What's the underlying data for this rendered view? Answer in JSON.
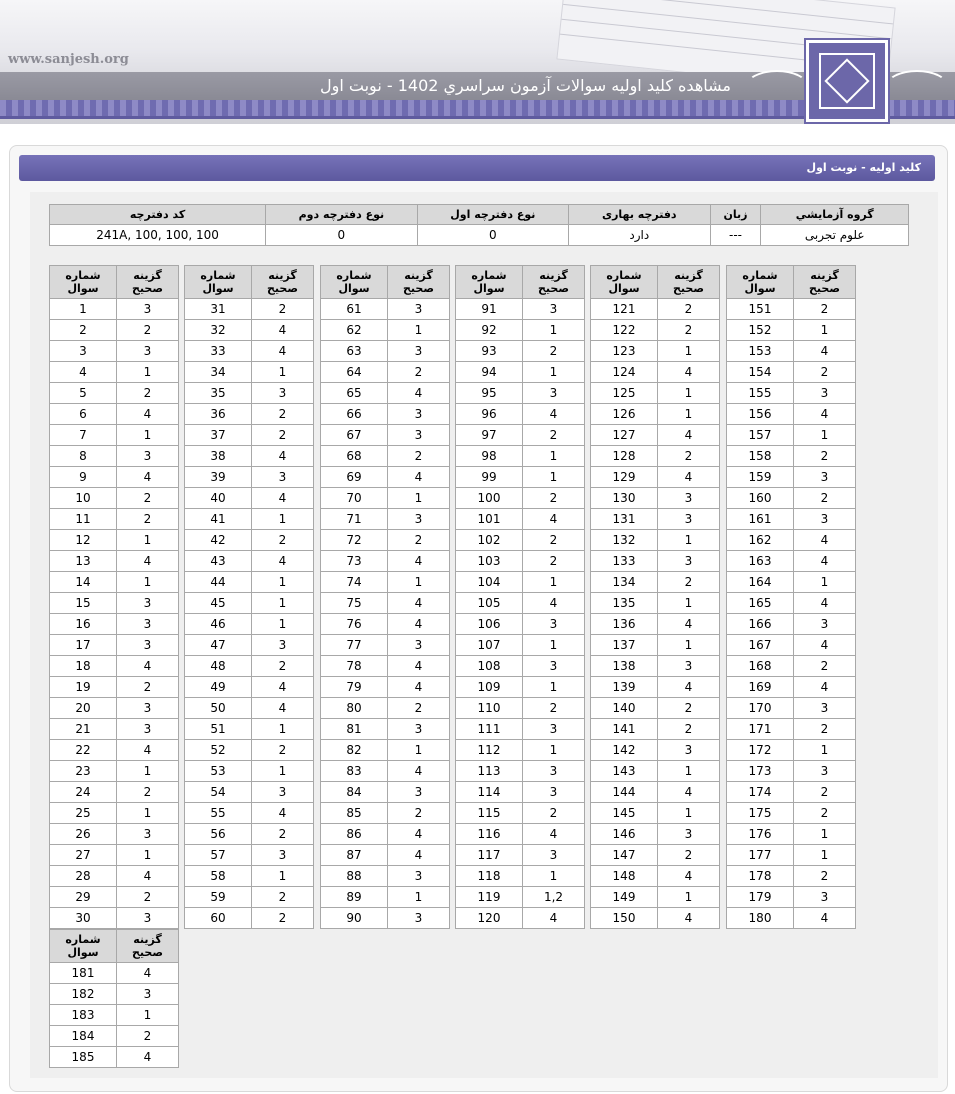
{
  "header": {
    "site": "www.sanjesh.org",
    "title": "مشاهده كليد اوليه سوالات آزمون سراسري 1402 - نوبت اول"
  },
  "panel": {
    "title": "كليد اوليه - نوبت اول"
  },
  "info": {
    "headers": [
      "كد دفترچه",
      "نوع دفترچه دوم",
      "نوع دفترچه اول",
      "دفترچه بهاری",
      "زبان",
      "گروه آزمايشي"
    ],
    "values": [
      "241A, 100, 100, 100",
      "0",
      "0",
      "دارد",
      "---",
      "علوم تجربی"
    ]
  },
  "answers": {
    "header_question": "شماره سوال",
    "header_answer": "گزينه صحيح",
    "q_header_line1": "شماره",
    "q_header_line2": "سوال",
    "a_header_line1": "گزينه",
    "a_header_line2": "صحيح",
    "rows": [
      [
        "1",
        "3"
      ],
      [
        "2",
        "2"
      ],
      [
        "3",
        "3"
      ],
      [
        "4",
        "1"
      ],
      [
        "5",
        "2"
      ],
      [
        "6",
        "4"
      ],
      [
        "7",
        "1"
      ],
      [
        "8",
        "3"
      ],
      [
        "9",
        "4"
      ],
      [
        "10",
        "2"
      ],
      [
        "11",
        "2"
      ],
      [
        "12",
        "1"
      ],
      [
        "13",
        "4"
      ],
      [
        "14",
        "1"
      ],
      [
        "15",
        "3"
      ],
      [
        "16",
        "3"
      ],
      [
        "17",
        "3"
      ],
      [
        "18",
        "4"
      ],
      [
        "19",
        "2"
      ],
      [
        "20",
        "3"
      ],
      [
        "21",
        "3"
      ],
      [
        "22",
        "4"
      ],
      [
        "23",
        "1"
      ],
      [
        "24",
        "2"
      ],
      [
        "25",
        "1"
      ],
      [
        "26",
        "3"
      ],
      [
        "27",
        "1"
      ],
      [
        "28",
        "4"
      ],
      [
        "29",
        "2"
      ],
      [
        "30",
        "3"
      ],
      [
        "31",
        "2"
      ],
      [
        "32",
        "4"
      ],
      [
        "33",
        "4"
      ],
      [
        "34",
        "1"
      ],
      [
        "35",
        "3"
      ],
      [
        "36",
        "2"
      ],
      [
        "37",
        "2"
      ],
      [
        "38",
        "4"
      ],
      [
        "39",
        "3"
      ],
      [
        "40",
        "4"
      ],
      [
        "41",
        "1"
      ],
      [
        "42",
        "2"
      ],
      [
        "43",
        "4"
      ],
      [
        "44",
        "1"
      ],
      [
        "45",
        "1"
      ],
      [
        "46",
        "1"
      ],
      [
        "47",
        "3"
      ],
      [
        "48",
        "2"
      ],
      [
        "49",
        "4"
      ],
      [
        "50",
        "4"
      ],
      [
        "51",
        "1"
      ],
      [
        "52",
        "2"
      ],
      [
        "53",
        "1"
      ],
      [
        "54",
        "3"
      ],
      [
        "55",
        "4"
      ],
      [
        "56",
        "2"
      ],
      [
        "57",
        "3"
      ],
      [
        "58",
        "1"
      ],
      [
        "59",
        "2"
      ],
      [
        "60",
        "2"
      ],
      [
        "61",
        "3"
      ],
      [
        "62",
        "1"
      ],
      [
        "63",
        "3"
      ],
      [
        "64",
        "2"
      ],
      [
        "65",
        "4"
      ],
      [
        "66",
        "3"
      ],
      [
        "67",
        "3"
      ],
      [
        "68",
        "2"
      ],
      [
        "69",
        "4"
      ],
      [
        "70",
        "1"
      ],
      [
        "71",
        "3"
      ],
      [
        "72",
        "2"
      ],
      [
        "73",
        "4"
      ],
      [
        "74",
        "1"
      ],
      [
        "75",
        "4"
      ],
      [
        "76",
        "4"
      ],
      [
        "77",
        "3"
      ],
      [
        "78",
        "4"
      ],
      [
        "79",
        "4"
      ],
      [
        "80",
        "2"
      ],
      [
        "81",
        "3"
      ],
      [
        "82",
        "1"
      ],
      [
        "83",
        "4"
      ],
      [
        "84",
        "3"
      ],
      [
        "85",
        "2"
      ],
      [
        "86",
        "4"
      ],
      [
        "87",
        "4"
      ],
      [
        "88",
        "3"
      ],
      [
        "89",
        "1"
      ],
      [
        "90",
        "3"
      ],
      [
        "91",
        "3"
      ],
      [
        "92",
        "1"
      ],
      [
        "93",
        "2"
      ],
      [
        "94",
        "1"
      ],
      [
        "95",
        "3"
      ],
      [
        "96",
        "4"
      ],
      [
        "97",
        "2"
      ],
      [
        "98",
        "1"
      ],
      [
        "99",
        "1"
      ],
      [
        "100",
        "2"
      ],
      [
        "101",
        "4"
      ],
      [
        "102",
        "2"
      ],
      [
        "103",
        "2"
      ],
      [
        "104",
        "1"
      ],
      [
        "105",
        "4"
      ],
      [
        "106",
        "3"
      ],
      [
        "107",
        "1"
      ],
      [
        "108",
        "3"
      ],
      [
        "109",
        "1"
      ],
      [
        "110",
        "2"
      ],
      [
        "111",
        "3"
      ],
      [
        "112",
        "1"
      ],
      [
        "113",
        "3"
      ],
      [
        "114",
        "3"
      ],
      [
        "115",
        "2"
      ],
      [
        "116",
        "4"
      ],
      [
        "117",
        "3"
      ],
      [
        "118",
        "1"
      ],
      [
        "119",
        "1,2"
      ],
      [
        "120",
        "4"
      ],
      [
        "121",
        "2"
      ],
      [
        "122",
        "2"
      ],
      [
        "123",
        "1"
      ],
      [
        "124",
        "4"
      ],
      [
        "125",
        "1"
      ],
      [
        "126",
        "1"
      ],
      [
        "127",
        "4"
      ],
      [
        "128",
        "2"
      ],
      [
        "129",
        "4"
      ],
      [
        "130",
        "3"
      ],
      [
        "131",
        "3"
      ],
      [
        "132",
        "1"
      ],
      [
        "133",
        "3"
      ],
      [
        "134",
        "2"
      ],
      [
        "135",
        "1"
      ],
      [
        "136",
        "4"
      ],
      [
        "137",
        "1"
      ],
      [
        "138",
        "3"
      ],
      [
        "139",
        "4"
      ],
      [
        "140",
        "2"
      ],
      [
        "141",
        "2"
      ],
      [
        "142",
        "3"
      ],
      [
        "143",
        "1"
      ],
      [
        "144",
        "4"
      ],
      [
        "145",
        "1"
      ],
      [
        "146",
        "3"
      ],
      [
        "147",
        "2"
      ],
      [
        "148",
        "4"
      ],
      [
        "149",
        "1"
      ],
      [
        "150",
        "4"
      ],
      [
        "151",
        "2"
      ],
      [
        "152",
        "1"
      ],
      [
        "153",
        "4"
      ],
      [
        "154",
        "2"
      ],
      [
        "155",
        "3"
      ],
      [
        "156",
        "4"
      ],
      [
        "157",
        "1"
      ],
      [
        "158",
        "2"
      ],
      [
        "159",
        "3"
      ],
      [
        "160",
        "2"
      ],
      [
        "161",
        "3"
      ],
      [
        "162",
        "4"
      ],
      [
        "163",
        "4"
      ],
      [
        "164",
        "1"
      ],
      [
        "165",
        "4"
      ],
      [
        "166",
        "3"
      ],
      [
        "167",
        "4"
      ],
      [
        "168",
        "2"
      ],
      [
        "169",
        "4"
      ],
      [
        "170",
        "3"
      ],
      [
        "171",
        "2"
      ],
      [
        "172",
        "1"
      ],
      [
        "173",
        "3"
      ],
      [
        "174",
        "2"
      ],
      [
        "175",
        "2"
      ],
      [
        "176",
        "1"
      ],
      [
        "177",
        "1"
      ],
      [
        "178",
        "2"
      ],
      [
        "179",
        "3"
      ],
      [
        "180",
        "4"
      ],
      [
        "181",
        "4"
      ],
      [
        "182",
        "3"
      ],
      [
        "183",
        "1"
      ],
      [
        "184",
        "2"
      ],
      [
        "185",
        "4"
      ]
    ]
  }
}
